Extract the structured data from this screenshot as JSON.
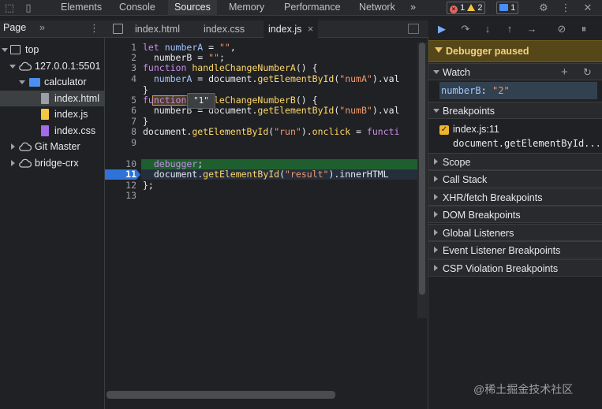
{
  "topbar": {
    "tabs": [
      "Elements",
      "Console",
      "Sources",
      "Memory",
      "Performance",
      "Network"
    ],
    "more": "»",
    "errors": "1",
    "warnings": "2",
    "messages": "1"
  },
  "navigator": {
    "tab": "Page",
    "more": "»",
    "tree": [
      {
        "label": "top"
      },
      {
        "label": "127.0.0.1:5501"
      },
      {
        "label": "calculator"
      },
      {
        "label": "index.html"
      },
      {
        "label": "index.js"
      },
      {
        "label": "index.css"
      },
      {
        "label": "Git Master"
      },
      {
        "label": "bridge-crx"
      }
    ]
  },
  "editor": {
    "tabs": [
      "index.html",
      "index.css",
      "index.js"
    ],
    "close": "×",
    "line_numbers": [
      "1",
      "2",
      "3",
      "4",
      "5",
      "6",
      "7",
      "8",
      "9",
      "10",
      "11",
      "12",
      "13"
    ],
    "tooltip": "\"1\"",
    "lines": {
      "l1a": "let ",
      "l1b": "numberA",
      "l1c": " = ",
      "l1d": "\"\"",
      "l1e": ",",
      "l2a": "  numberB = ",
      "l2b": "\"\"",
      "l2c": ";",
      "l3a": "function ",
      "l3b": "handleChangeNumberA",
      "l3c": "() {",
      "l4a": "  numberA",
      "l4b": " = document.",
      "l4c": "getElementById",
      "l4d": "(",
      "l4e": "\"numA\"",
      "l4f": ").val",
      "l5a": "}",
      "l6a": "function ",
      "l6b": "handleChangeNumberB",
      "l6c": "() {",
      "l7a": "  numberB = document.",
      "l7b": "getElementById",
      "l7c": "(",
      "l7d": "\"numB\"",
      "l7e": ").val",
      "l8a": "}",
      "l9a": "document.",
      "l9b": "getElementById",
      "l9c": "(",
      "l9d": "\"run\"",
      "l9e": ").",
      "l9f": "onclick",
      "l9g": " = ",
      "l9h": "functi",
      "l10a": "  debugger",
      "l10b": ";",
      "l11a": "  document.",
      "l11b": "getElementById",
      "l11c": "(",
      "l11d": "\"result\"",
      "l11e": ").innerHTML",
      "l12a": "};"
    }
  },
  "debugger": {
    "paused": "Debugger paused",
    "watch": {
      "title": "Watch",
      "expr": "numberB",
      "sep": ": ",
      "value": "\"2\""
    },
    "breakpoints": {
      "title": "Breakpoints",
      "file": "index.js:11",
      "code": "document.getElementById..."
    },
    "sections": [
      "Scope",
      "Call Stack",
      "XHR/fetch Breakpoints",
      "DOM Breakpoints",
      "Global Listeners",
      "Event Listener Breakpoints",
      "CSP Violation Breakpoints"
    ]
  },
  "watermark": "@稀土掘金技术社区",
  "colors": {
    "accent": "#4b8ff0",
    "paused_bg": "#564719",
    "breakpoint": "#2f73d9"
  }
}
